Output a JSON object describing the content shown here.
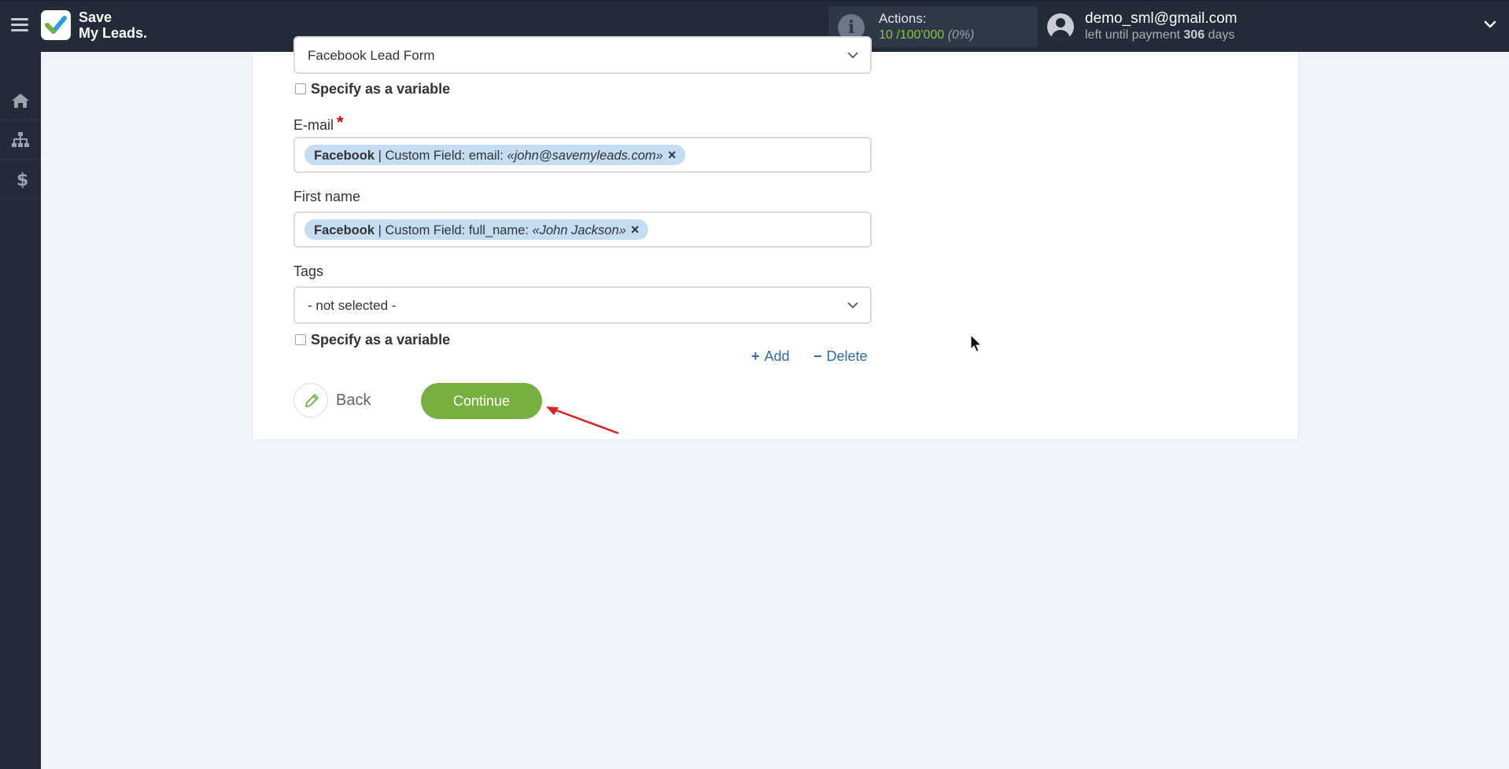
{
  "app": {
    "logo_line1": "Save",
    "logo_line2": "My Leads."
  },
  "header": {
    "actions_label": "Actions:",
    "actions_used": "10",
    "actions_sep": " /",
    "actions_total": "100'000",
    "actions_percent": "(0%)",
    "user_email": "demo_sml@gmail.com",
    "payment_prefix": "left until payment ",
    "payment_days": "306",
    "payment_suffix": " days"
  },
  "sidebar": {
    "items": [
      {
        "icon": "home-icon"
      },
      {
        "icon": "sitemap-icon"
      },
      {
        "icon": "dollar-icon"
      }
    ]
  },
  "form": {
    "top_select_value": "Facebook Lead Form",
    "specify_variable_label": "Specify as a variable",
    "email": {
      "label": "E-mail",
      "required_mark": "*",
      "chip_source": "Facebook",
      "chip_field": " | Custom Field: email: ",
      "chip_value": "«john@savemyleads.com»",
      "chip_remove": "×"
    },
    "first_name": {
      "label": "First name",
      "chip_source": "Facebook",
      "chip_field": " | Custom Field: full_name: ",
      "chip_value": "«John Jackson»",
      "chip_remove": "×"
    },
    "tags": {
      "label": "Tags",
      "value": "- not selected -"
    },
    "add_label": "Add",
    "delete_label": "Delete",
    "back_label": "Back",
    "continue_label": "Continue"
  },
  "colors": {
    "topbar": "#232b38",
    "accent_green": "#77b041",
    "chip_blue": "#c5ddf3",
    "link_blue": "#2a6fb4",
    "annotation_red": "#e02020"
  }
}
